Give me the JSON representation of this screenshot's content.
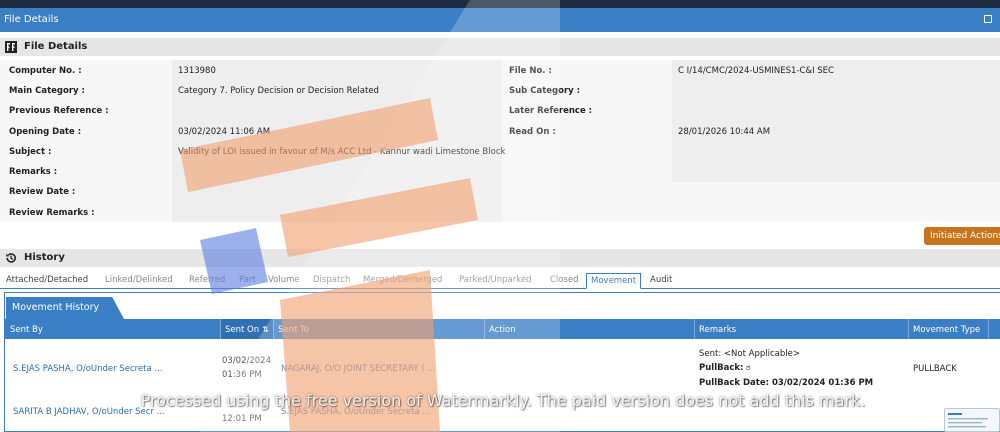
{
  "window": {
    "title": "File Details"
  },
  "file_details": {
    "section_title": "File Details",
    "rows": [
      {
        "k1": "Computer No. :",
        "v1": "1313980",
        "k2": "File No. :",
        "v2": "C I/14/CMC/2024-USMINES1-C&I SEC"
      },
      {
        "k1": "Main Category :",
        "v1": "Category 7. Policy Decision or Decision Related",
        "k2": "Sub Category :",
        "v2": ""
      },
      {
        "k1": "Previous Reference :",
        "v1": "",
        "k2": "Later Reference :",
        "v2": ""
      },
      {
        "k1": "Opening Date :",
        "v1": "03/02/2024 11:06 AM",
        "k2": "Read On :",
        "v2": "28/01/2026 10:44 AM"
      },
      {
        "k1": "Subject :",
        "v1": "Validity of LOI issued in favour of M/s ACC Ltd - Kannur wadi Limestone Block",
        "k2": "",
        "v2": ""
      },
      {
        "k1": "Remarks :",
        "v1": "",
        "k2": "",
        "v2": ""
      },
      {
        "k1": "Review Date :",
        "v1": "",
        "k2": "",
        "v2": ""
      },
      {
        "k1": "Review Remarks :",
        "v1": "",
        "k2": "",
        "v2": ""
      }
    ]
  },
  "actions": {
    "initiated": "Initiated Actions"
  },
  "history": {
    "section_title": "History",
    "tabs": [
      "Attached/Detached",
      "Linked/Delinked",
      "Referred",
      "Part",
      "Volume",
      "Dispatch",
      "Merged/Demerged",
      "Parked/Unparked",
      "Closed",
      "Movement",
      "Audit"
    ],
    "active_tab": "Movement"
  },
  "movement": {
    "panel_title": "Movement History",
    "columns": [
      "Sent By",
      "Sent On",
      "Sent To",
      "Action",
      "Remarks",
      "Movement Type"
    ],
    "sort_glyph": "⇅",
    "rows": [
      {
        "sent_by": "S.EJAS PASHA, O/oUnder Secreta ...",
        "sent_on_date": "03/02/2024",
        "sent_on_time": "01:36 PM",
        "sent_to": "NAGARAJ, O/O JOINT SECRETARY ( ...",
        "action": "",
        "remarks_sent": "Sent: <Not Applicable>",
        "remarks_pullback_label": "PullBack:",
        "remarks_pullback_value": "ಠ",
        "remarks_pullback_date": "PullBack Date: 03/02/2024 01:36 PM",
        "movement_type": "PULLBACK"
      },
      {
        "sent_by": "SARITA B JADHAV, O/oUnder Secr ...",
        "sent_on_date": "",
        "sent_on_time": "12:01 PM",
        "sent_to": "S.EJAS PASHA, O/oUnder Secreta ...",
        "action": "",
        "movement_type": ""
      }
    ]
  },
  "watermark": {
    "text": "Processed using the free version of Watermarkly. The paid version does not add this mark."
  },
  "colors": {
    "accent": "#3a7fc6",
    "header_dark": "#1c2b3f",
    "action_orange": "#c8741c",
    "logo_orange": "#f0a070",
    "logo_blue": "#6080e0"
  }
}
